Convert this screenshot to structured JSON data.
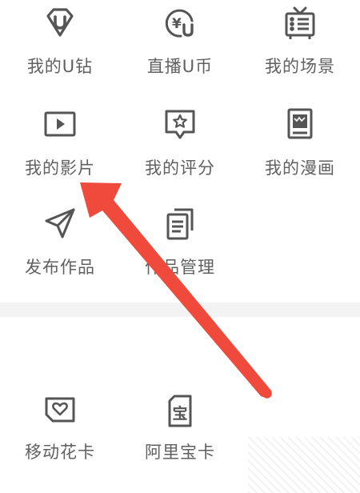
{
  "grid": {
    "items": [
      {
        "label": "我的U钻",
        "icon": "u-diamond-icon"
      },
      {
        "label": "直播U币",
        "icon": "u-coin-icon"
      },
      {
        "label": "我的场景",
        "icon": "tv-scene-icon"
      },
      {
        "label": "我的影片",
        "icon": "video-play-icon"
      },
      {
        "label": "我的评分",
        "icon": "rating-star-icon"
      },
      {
        "label": "我的漫画",
        "icon": "comic-book-icon"
      },
      {
        "label": "发布作品",
        "icon": "paper-plane-icon"
      },
      {
        "label": "作品管理",
        "icon": "documents-icon"
      }
    ]
  },
  "cards": {
    "items": [
      {
        "label": "移动花卡",
        "icon": "sim-card-heart-icon"
      },
      {
        "label": "阿里宝卡",
        "icon": "sim-card-bao-icon"
      }
    ]
  },
  "icon_glyphs": {
    "coin": "¥",
    "bao": "宝"
  },
  "colors": {
    "icon": "#555555",
    "label": "#606060",
    "arrow": "#f04a3c",
    "divider": "#f3f3f3"
  }
}
